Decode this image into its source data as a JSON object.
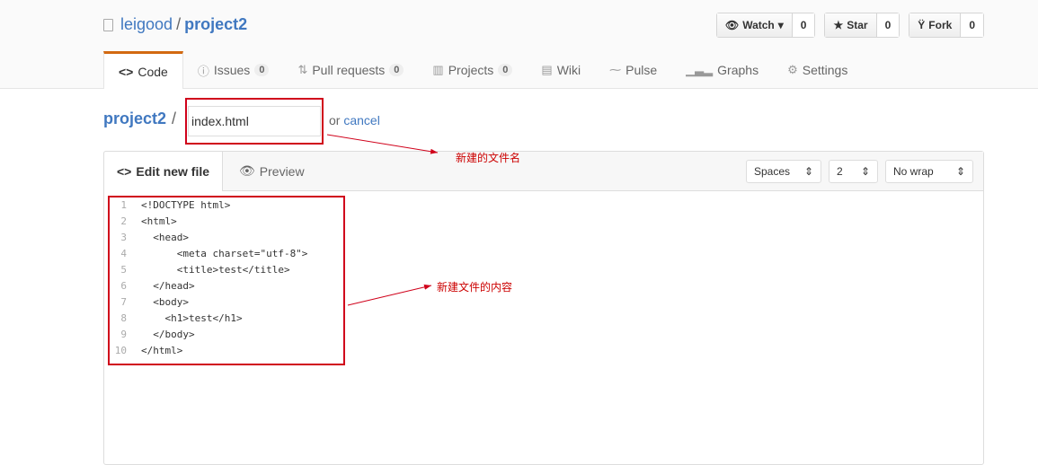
{
  "repo": {
    "owner": "leigood",
    "separator": "/",
    "name": "project2"
  },
  "actions": [
    {
      "label": "Watch",
      "icon": "eye-icon",
      "count": "0",
      "caret": "▾"
    },
    {
      "label": "Star",
      "icon": "star-icon",
      "count": "0"
    },
    {
      "label": "Fork",
      "icon": "fork-icon",
      "count": "0"
    }
  ],
  "tabs": [
    {
      "label": "Code",
      "icon": "code-icon",
      "selected": true
    },
    {
      "label": "Issues",
      "icon": "issue-icon",
      "count": "0"
    },
    {
      "label": "Pull requests",
      "icon": "pull-request-icon",
      "count": "0"
    },
    {
      "label": "Projects",
      "icon": "project-icon",
      "count": "0"
    },
    {
      "label": "Wiki",
      "icon": "book-icon"
    },
    {
      "label": "Pulse",
      "icon": "pulse-icon"
    },
    {
      "label": "Graphs",
      "icon": "graph-icon"
    },
    {
      "label": "Settings",
      "icon": "gear-icon"
    }
  ],
  "breadcrumb": {
    "repo": "project2",
    "separator": "/"
  },
  "filename": {
    "value": "index.html"
  },
  "cancel": {
    "prefix": "or",
    "link": "cancel"
  },
  "editor": {
    "tabs": {
      "edit": "Edit new file",
      "preview": "Preview"
    },
    "indent_mode": "Spaces",
    "indent_size": "2",
    "wrap_mode": "No wrap",
    "lines": [
      "<!DOCTYPE html>",
      "<html>",
      "  <head>",
      "      <meta charset=\"utf-8\">",
      "      <title>test</title>",
      "  </head>",
      "  <body>",
      "    <h1>test</h1>",
      "  </body>",
      "</html>"
    ]
  },
  "annotations": {
    "filename": "新建的文件名",
    "content": "新建文件的内容"
  },
  "colors": {
    "accent": "#d26911",
    "link": "#4078c0",
    "annotation": "#d0021b"
  }
}
